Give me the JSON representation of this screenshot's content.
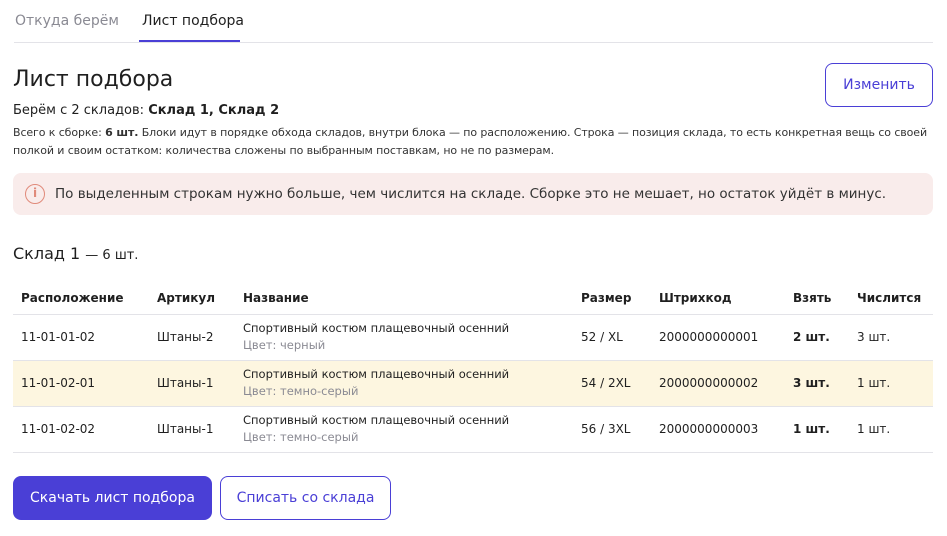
{
  "tabs": [
    {
      "label": "Откуда берём"
    },
    {
      "label": "Лист подбора"
    }
  ],
  "header": {
    "title": "Лист подбора",
    "edit_label": "Изменить"
  },
  "summary": {
    "prefix": "Берём с 2 складов: ",
    "warehouses": "Склад 1, Склад 2",
    "total_prefix": "Всего к сборке: ",
    "total": "6 шт.",
    "description": " Блоки идут в порядке обхода складов, внутри блока — по расположению. Строка — позиция склада, то есть конкретная вещь со своей полкой и своим остатком: количества сложены по выбранным поставкам, но не по размерам."
  },
  "alert": {
    "icon": "info-icon",
    "text": "По выделенным строкам нужно больше, чем числится на складе. Сборке это не мешает, но остаток уйдёт в минус."
  },
  "warehouse": {
    "name": "Склад 1",
    "count": "— 6 шт."
  },
  "table": {
    "headers": [
      "Расположение",
      "Артикул",
      "Название",
      "Размер",
      "Штрихкод",
      "Взять",
      "Числится"
    ],
    "rows": [
      {
        "location": "11-01-01-02",
        "article": "Штаны-2",
        "name": "Спортивный костюм плащевочный осенний",
        "color": "Цвет: черный",
        "size": "52 / XL",
        "barcode": "2000000000001",
        "take": "2 шт.",
        "stock": "3 шт."
      },
      {
        "location": "11-01-02-01",
        "article": "Штаны-1",
        "name": "Спортивный костюм плащевочный осенний",
        "color": "Цвет: темно-серый",
        "size": "54 / 2XL",
        "barcode": "2000000000002",
        "take": "3 шт.",
        "stock": "1 шт."
      },
      {
        "location": "11-01-02-02",
        "article": "Штаны-1",
        "name": "Спортивный костюм плащевочный осенний",
        "color": "Цвет: темно-серый",
        "size": "56 / 3XL",
        "barcode": "2000000000003",
        "take": "1 шт.",
        "stock": "1 шт."
      }
    ]
  },
  "actions": {
    "download_label": "Скачать лист подбора",
    "writeoff_label": "Списать со склада"
  },
  "colors": {
    "accent": "#4a3fd6",
    "alert_bg": "#f9eceb",
    "highlight_row": "#fdf6e0"
  }
}
